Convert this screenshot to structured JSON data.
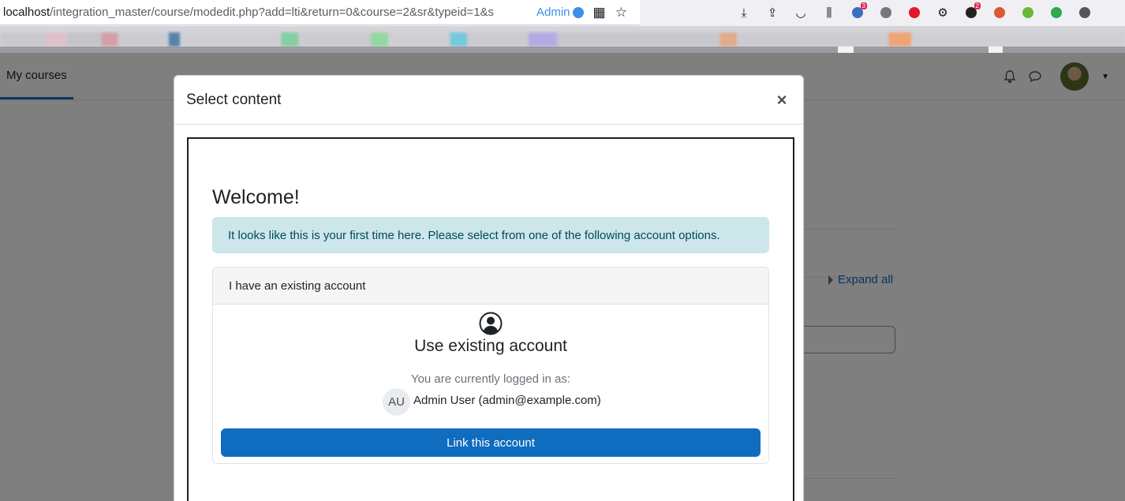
{
  "browser": {
    "url_host": "localhost",
    "url_path": "/integration_master/course/modedit.php?add=lti&return=0&course=2&sr&typeid=1&s",
    "container_label": "Admin"
  },
  "navbar": {
    "my_courses": "My courses"
  },
  "background": {
    "expand_all": "Expand all"
  },
  "modal": {
    "title": "Select content",
    "close_symbol": "×",
    "welcome": "Welcome!",
    "alert_text": "It looks like this is your first time here. Please select from one of the following account options.",
    "card": {
      "header": "I have an existing account",
      "heading": "Use existing account",
      "logged_in_label": "You are currently logged in as:",
      "user_initials": "AU",
      "user_name": "Admin User (admin@example.com)",
      "button_label": "Link this account"
    }
  },
  "colors": {
    "primary": "#0f6cbf",
    "alert_bg": "#cce6ea",
    "alert_text": "#004b5a"
  }
}
